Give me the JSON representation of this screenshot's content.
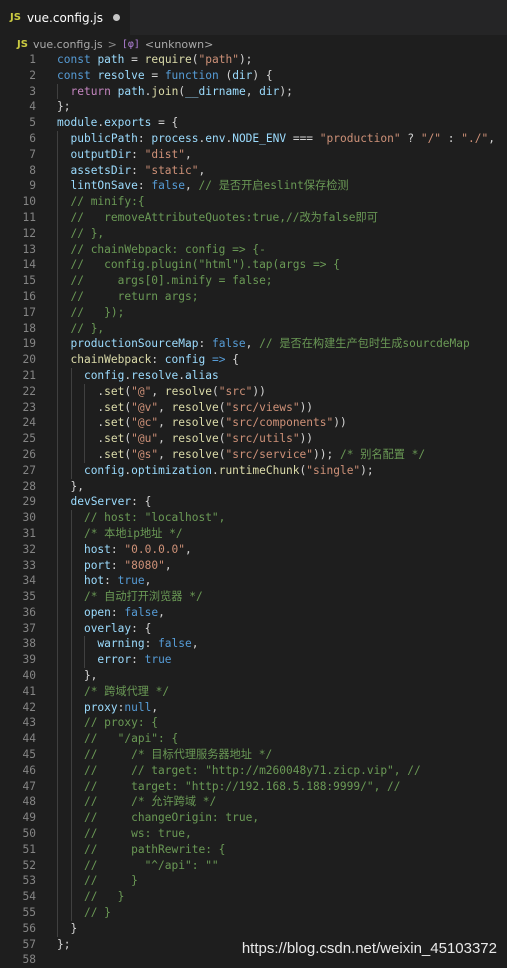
{
  "tab": {
    "badge": "JS",
    "filename": "vue.config.js"
  },
  "breadcrumb": {
    "badge": "JS",
    "file": "vue.config.js",
    "separator": ">",
    "symbol_icon": "[φ]",
    "symbol": "<unknown>"
  },
  "colors": {
    "keyword": "#569cd6",
    "control": "#c586c0",
    "variable": "#9cdcfe",
    "function": "#dcdcaa",
    "string": "#ce9178",
    "comment": "#6a9955",
    "plain": "#d4d4d4"
  },
  "code_lines": [
    {
      "n": "1",
      "tokens": [
        [
          "kw",
          "const"
        ],
        [
          "pl",
          " "
        ],
        [
          "var",
          "path"
        ],
        [
          "pl",
          " = "
        ],
        [
          "fn",
          "require"
        ],
        [
          "pl",
          "("
        ],
        [
          "str",
          "\"path\""
        ],
        [
          "pl",
          ");"
        ]
      ]
    },
    {
      "n": "2",
      "tokens": [
        [
          "kw",
          "const"
        ],
        [
          "pl",
          " "
        ],
        [
          "var",
          "resolve"
        ],
        [
          "pl",
          " = "
        ],
        [
          "kw",
          "function"
        ],
        [
          "pl",
          " ("
        ],
        [
          "var",
          "dir"
        ],
        [
          "pl",
          ") {"
        ]
      ]
    },
    {
      "n": "3",
      "tokens": [
        [
          "pl",
          "  "
        ],
        [
          "ctl",
          "return"
        ],
        [
          "pl",
          " "
        ],
        [
          "var",
          "path"
        ],
        [
          "pl",
          "."
        ],
        [
          "fn",
          "join"
        ],
        [
          "pl",
          "("
        ],
        [
          "var",
          "__dirname"
        ],
        [
          "pl",
          ", "
        ],
        [
          "var",
          "dir"
        ],
        [
          "pl",
          ");"
        ]
      ]
    },
    {
      "n": "4",
      "tokens": [
        [
          "pl",
          "};"
        ]
      ]
    },
    {
      "n": "5",
      "tokens": [
        [
          "var",
          "module"
        ],
        [
          "pl",
          "."
        ],
        [
          "var",
          "exports"
        ],
        [
          "pl",
          " = {"
        ]
      ]
    },
    {
      "n": "6",
      "tokens": [
        [
          "pl",
          "  "
        ],
        [
          "var",
          "publicPath"
        ],
        [
          "pl",
          ": "
        ],
        [
          "var",
          "process"
        ],
        [
          "pl",
          "."
        ],
        [
          "var",
          "env"
        ],
        [
          "pl",
          "."
        ],
        [
          "var",
          "NODE_ENV"
        ],
        [
          "pl",
          " === "
        ],
        [
          "str",
          "\"production\""
        ],
        [
          "pl",
          " ? "
        ],
        [
          "str",
          "\"/\""
        ],
        [
          "pl",
          " : "
        ],
        [
          "str",
          "\"./\""
        ],
        [
          "pl",
          ","
        ]
      ]
    },
    {
      "n": "7",
      "tokens": [
        [
          "pl",
          "  "
        ],
        [
          "var",
          "outputDir"
        ],
        [
          "pl",
          ": "
        ],
        [
          "str",
          "\"dist\""
        ],
        [
          "pl",
          ","
        ]
      ]
    },
    {
      "n": "8",
      "tokens": [
        [
          "pl",
          "  "
        ],
        [
          "var",
          "assetsDir"
        ],
        [
          "pl",
          ": "
        ],
        [
          "str",
          "\"static\""
        ],
        [
          "pl",
          ","
        ]
      ]
    },
    {
      "n": "9",
      "tokens": [
        [
          "pl",
          "  "
        ],
        [
          "var",
          "lintOnSave"
        ],
        [
          "pl",
          ": "
        ],
        [
          "kw",
          "false"
        ],
        [
          "pl",
          ", "
        ],
        [
          "cm",
          "// 是否开启eslint保存检测"
        ]
      ]
    },
    {
      "n": "10",
      "tokens": [
        [
          "pl",
          "  "
        ],
        [
          "cm",
          "// minify:{"
        ]
      ]
    },
    {
      "n": "11",
      "tokens": [
        [
          "pl",
          "  "
        ],
        [
          "cm",
          "//   removeAttributeQuotes:true,//改为false即可"
        ]
      ]
    },
    {
      "n": "12",
      "tokens": [
        [
          "pl",
          "  "
        ],
        [
          "cm",
          "// },"
        ]
      ]
    },
    {
      "n": "13",
      "tokens": [
        [
          "pl",
          "  "
        ],
        [
          "cm",
          "// chainWebpack: config => {-"
        ]
      ]
    },
    {
      "n": "14",
      "tokens": [
        [
          "pl",
          "  "
        ],
        [
          "cm",
          "//   config.plugin(\"html\").tap(args => {"
        ]
      ]
    },
    {
      "n": "15",
      "tokens": [
        [
          "pl",
          "  "
        ],
        [
          "cm",
          "//     args[0].minify = false;"
        ]
      ]
    },
    {
      "n": "16",
      "tokens": [
        [
          "pl",
          "  "
        ],
        [
          "cm",
          "//     return args;"
        ]
      ]
    },
    {
      "n": "17",
      "tokens": [
        [
          "pl",
          "  "
        ],
        [
          "cm",
          "//   });"
        ]
      ]
    },
    {
      "n": "18",
      "tokens": [
        [
          "pl",
          "  "
        ],
        [
          "cm",
          "// },"
        ]
      ]
    },
    {
      "n": "19",
      "tokens": [
        [
          "pl",
          "  "
        ],
        [
          "var",
          "productionSourceMap"
        ],
        [
          "pl",
          ": "
        ],
        [
          "kw",
          "false"
        ],
        [
          "pl",
          ", "
        ],
        [
          "cm",
          "// 是否在构建生产包时生成sourcdeMap"
        ]
      ]
    },
    {
      "n": "20",
      "tokens": [
        [
          "pl",
          "  "
        ],
        [
          "fn",
          "chainWebpack"
        ],
        [
          "pl",
          ": "
        ],
        [
          "var",
          "config"
        ],
        [
          "pl",
          " "
        ],
        [
          "kw",
          "=>"
        ],
        [
          "pl",
          " {"
        ]
      ]
    },
    {
      "n": "21",
      "tokens": [
        [
          "pl",
          "    "
        ],
        [
          "var",
          "config"
        ],
        [
          "pl",
          "."
        ],
        [
          "var",
          "resolve"
        ],
        [
          "pl",
          "."
        ],
        [
          "var",
          "alias"
        ]
      ]
    },
    {
      "n": "22",
      "tokens": [
        [
          "pl",
          "      ."
        ],
        [
          "fn",
          "set"
        ],
        [
          "pl",
          "("
        ],
        [
          "str",
          "\"@\""
        ],
        [
          "pl",
          ", "
        ],
        [
          "fn",
          "resolve"
        ],
        [
          "pl",
          "("
        ],
        [
          "str",
          "\"src\""
        ],
        [
          "pl",
          "))"
        ]
      ]
    },
    {
      "n": "23",
      "tokens": [
        [
          "pl",
          "      ."
        ],
        [
          "fn",
          "set"
        ],
        [
          "pl",
          "("
        ],
        [
          "str",
          "\"@v\""
        ],
        [
          "pl",
          ", "
        ],
        [
          "fn",
          "resolve"
        ],
        [
          "pl",
          "("
        ],
        [
          "str",
          "\"src/views\""
        ],
        [
          "pl",
          "))"
        ]
      ]
    },
    {
      "n": "24",
      "tokens": [
        [
          "pl",
          "      ."
        ],
        [
          "fn",
          "set"
        ],
        [
          "pl",
          "("
        ],
        [
          "str",
          "\"@c\""
        ],
        [
          "pl",
          ", "
        ],
        [
          "fn",
          "resolve"
        ],
        [
          "pl",
          "("
        ],
        [
          "str",
          "\"src/components\""
        ],
        [
          "pl",
          "))"
        ]
      ]
    },
    {
      "n": "25",
      "tokens": [
        [
          "pl",
          "      ."
        ],
        [
          "fn",
          "set"
        ],
        [
          "pl",
          "("
        ],
        [
          "str",
          "\"@u\""
        ],
        [
          "pl",
          ", "
        ],
        [
          "fn",
          "resolve"
        ],
        [
          "pl",
          "("
        ],
        [
          "str",
          "\"src/utils\""
        ],
        [
          "pl",
          "))"
        ]
      ]
    },
    {
      "n": "26",
      "tokens": [
        [
          "pl",
          "      ."
        ],
        [
          "fn",
          "set"
        ],
        [
          "pl",
          "("
        ],
        [
          "str",
          "\"@s\""
        ],
        [
          "pl",
          ", "
        ],
        [
          "fn",
          "resolve"
        ],
        [
          "pl",
          "("
        ],
        [
          "str",
          "\"src/service\""
        ],
        [
          "pl",
          ")); "
        ],
        [
          "cm",
          "/* 别名配置 */"
        ]
      ]
    },
    {
      "n": "27",
      "tokens": [
        [
          "pl",
          "    "
        ],
        [
          "var",
          "config"
        ],
        [
          "pl",
          "."
        ],
        [
          "var",
          "optimization"
        ],
        [
          "pl",
          "."
        ],
        [
          "fn",
          "runtimeChunk"
        ],
        [
          "pl",
          "("
        ],
        [
          "str",
          "\"single\""
        ],
        [
          "pl",
          ");"
        ]
      ]
    },
    {
      "n": "28",
      "tokens": [
        [
          "pl",
          "  },"
        ]
      ]
    },
    {
      "n": "29",
      "tokens": [
        [
          "pl",
          "  "
        ],
        [
          "var",
          "devServer"
        ],
        [
          "pl",
          ": {"
        ]
      ]
    },
    {
      "n": "30",
      "tokens": [
        [
          "pl",
          "    "
        ],
        [
          "cm",
          "// host: \"localhost\","
        ]
      ]
    },
    {
      "n": "31",
      "tokens": [
        [
          "pl",
          "    "
        ],
        [
          "cm",
          "/* 本地ip地址 */"
        ]
      ]
    },
    {
      "n": "32",
      "tokens": [
        [
          "pl",
          "    "
        ],
        [
          "var",
          "host"
        ],
        [
          "pl",
          ": "
        ],
        [
          "str",
          "\"0.0.0.0\""
        ],
        [
          "pl",
          ","
        ]
      ]
    },
    {
      "n": "33",
      "tokens": [
        [
          "pl",
          "    "
        ],
        [
          "var",
          "port"
        ],
        [
          "pl",
          ": "
        ],
        [
          "str",
          "\"8080\""
        ],
        [
          "pl",
          ","
        ]
      ]
    },
    {
      "n": "34",
      "tokens": [
        [
          "pl",
          "    "
        ],
        [
          "var",
          "hot"
        ],
        [
          "pl",
          ": "
        ],
        [
          "kw",
          "true"
        ],
        [
          "pl",
          ","
        ]
      ]
    },
    {
      "n": "35",
      "tokens": [
        [
          "pl",
          "    "
        ],
        [
          "cm",
          "/* 自动打开浏览器 */"
        ]
      ]
    },
    {
      "n": "36",
      "tokens": [
        [
          "pl",
          "    "
        ],
        [
          "var",
          "open"
        ],
        [
          "pl",
          ": "
        ],
        [
          "kw",
          "false"
        ],
        [
          "pl",
          ","
        ]
      ]
    },
    {
      "n": "37",
      "tokens": [
        [
          "pl",
          "    "
        ],
        [
          "var",
          "overlay"
        ],
        [
          "pl",
          ": {"
        ]
      ]
    },
    {
      "n": "38",
      "tokens": [
        [
          "pl",
          "      "
        ],
        [
          "var",
          "warning"
        ],
        [
          "pl",
          ": "
        ],
        [
          "kw",
          "false"
        ],
        [
          "pl",
          ","
        ]
      ]
    },
    {
      "n": "39",
      "tokens": [
        [
          "pl",
          "      "
        ],
        [
          "var",
          "error"
        ],
        [
          "pl",
          ": "
        ],
        [
          "kw",
          "true"
        ]
      ]
    },
    {
      "n": "40",
      "tokens": [
        [
          "pl",
          "    },"
        ]
      ]
    },
    {
      "n": "41",
      "tokens": [
        [
          "pl",
          "    "
        ],
        [
          "cm",
          "/* 跨域代理 */"
        ]
      ]
    },
    {
      "n": "42",
      "tokens": [
        [
          "pl",
          "    "
        ],
        [
          "var",
          "proxy"
        ],
        [
          "pl",
          ":"
        ],
        [
          "kw",
          "null"
        ],
        [
          "pl",
          ","
        ]
      ]
    },
    {
      "n": "43",
      "tokens": [
        [
          "pl",
          "    "
        ],
        [
          "cm",
          "// proxy: {"
        ]
      ]
    },
    {
      "n": "44",
      "tokens": [
        [
          "pl",
          "    "
        ],
        [
          "cm",
          "//   \"/api\": {"
        ]
      ]
    },
    {
      "n": "45",
      "tokens": [
        [
          "pl",
          "    "
        ],
        [
          "cm",
          "//     /* 目标代理服务器地址 */"
        ]
      ]
    },
    {
      "n": "46",
      "tokens": [
        [
          "pl",
          "    "
        ],
        [
          "cm",
          "//     // target: \"http://m260048y71.zicp.vip\", //"
        ]
      ]
    },
    {
      "n": "47",
      "tokens": [
        [
          "pl",
          "    "
        ],
        [
          "cm",
          "//     target: \"http://192.168.5.188:9999/\", //"
        ]
      ]
    },
    {
      "n": "48",
      "tokens": [
        [
          "pl",
          "    "
        ],
        [
          "cm",
          "//     /* 允许跨域 */"
        ]
      ]
    },
    {
      "n": "49",
      "tokens": [
        [
          "pl",
          "    "
        ],
        [
          "cm",
          "//     changeOrigin: true,"
        ]
      ]
    },
    {
      "n": "50",
      "tokens": [
        [
          "pl",
          "    "
        ],
        [
          "cm",
          "//     ws: true,"
        ]
      ]
    },
    {
      "n": "51",
      "tokens": [
        [
          "pl",
          "    "
        ],
        [
          "cm",
          "//     pathRewrite: {"
        ]
      ]
    },
    {
      "n": "52",
      "tokens": [
        [
          "pl",
          "    "
        ],
        [
          "cm",
          "//       \"^/api\": \"\""
        ]
      ]
    },
    {
      "n": "53",
      "tokens": [
        [
          "pl",
          "    "
        ],
        [
          "cm",
          "//     }"
        ]
      ]
    },
    {
      "n": "54",
      "tokens": [
        [
          "pl",
          "    "
        ],
        [
          "cm",
          "//   }"
        ]
      ]
    },
    {
      "n": "55",
      "tokens": [
        [
          "pl",
          "    "
        ],
        [
          "cm",
          "// }"
        ]
      ]
    },
    {
      "n": "56",
      "tokens": [
        [
          "pl",
          "  }"
        ]
      ]
    },
    {
      "n": "57",
      "tokens": [
        [
          "pl",
          "};"
        ]
      ]
    },
    {
      "n": "58",
      "tokens": []
    }
  ],
  "watermark": "https://blog.csdn.net/weixin_45103372"
}
